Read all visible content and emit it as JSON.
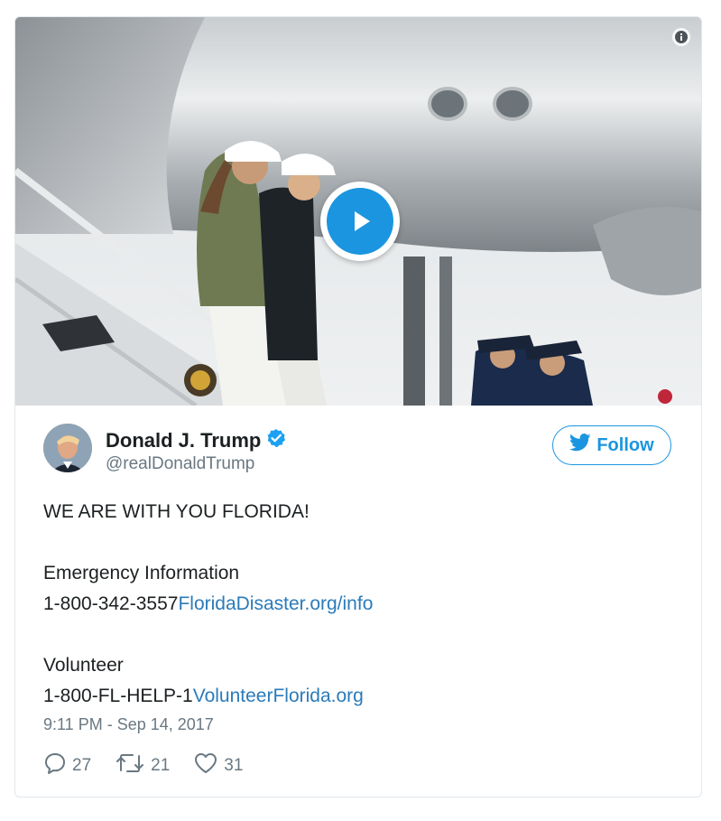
{
  "media": {
    "type": "video",
    "play_icon": "play-icon",
    "info_icon": "info-icon"
  },
  "author": {
    "display_name": "Donald J. Trump",
    "screen_name": "@realDonaldTrump",
    "verified_icon": "verified-badge-icon"
  },
  "follow": {
    "label": "Follow",
    "icon": "twitter-bird-icon"
  },
  "tweet": {
    "line1": "WE ARE WITH YOU FLORIDA!",
    "emergency_label": "Emergency Information",
    "emergency_phone": "1-800-342-3557",
    "emergency_link": "FloridaDisaster.org/info",
    "volunteer_label": "Volunteer",
    "volunteer_phone": "1-800-FL-HELP-1",
    "volunteer_link": "VolunteerFlorida.org"
  },
  "timestamp": "9:11 PM - Sep 14, 2017",
  "actions": {
    "replies": "27",
    "retweets": "21",
    "likes": "31"
  },
  "colors": {
    "accent": "#1b95e0",
    "link": "#2b7bb9",
    "muted": "#697882",
    "text": "#1c2022",
    "border": "#e1e8ed"
  }
}
